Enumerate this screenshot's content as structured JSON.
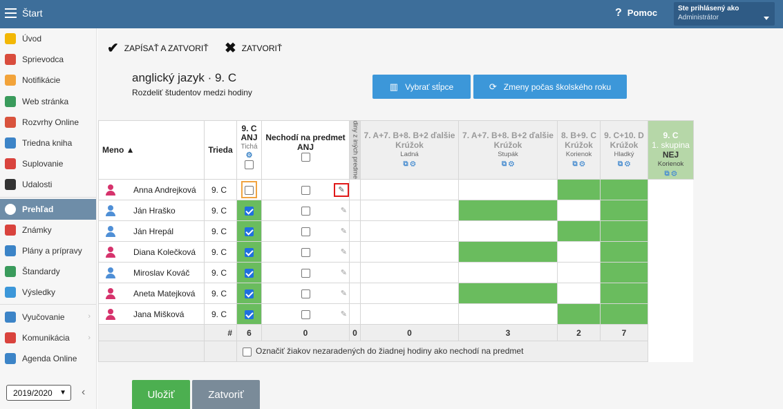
{
  "topbar": {
    "title": "Štart",
    "help": "Pomoc",
    "help_icon": "?",
    "user_label": "Ste prihlásený ako",
    "user_name": "Administrátor"
  },
  "sidebar": {
    "items": [
      {
        "label": "Úvod",
        "icon": "star-icon",
        "color": "#f2b705"
      },
      {
        "label": "Sprievodca",
        "icon": "wand-icon",
        "color": "#d94c3d"
      },
      {
        "label": "Notifikácie",
        "icon": "envelope-icon",
        "color": "#f2a33a"
      },
      {
        "label": "Web stránka",
        "icon": "house-icon",
        "color": "#3a9b5c"
      },
      {
        "label": "Rozvrhy Online",
        "icon": "calendar-grid-icon",
        "color": "#d9533d"
      },
      {
        "label": "Triedna kniha",
        "icon": "book-icon",
        "color": "#3c84c7"
      },
      {
        "label": "Suplovanie",
        "icon": "person-swap-icon",
        "color": "#d9433d"
      },
      {
        "label": "Udalosti",
        "icon": "calendar-icon",
        "color": "#333333"
      },
      {
        "label": "Prehľad",
        "icon": "check-circle-icon",
        "color": "#ffffff",
        "active": true
      },
      {
        "label": "Známky",
        "icon": "grade-icon",
        "color": "#d9433d"
      },
      {
        "label": "Plány a prípravy",
        "icon": "briefcase-icon",
        "color": "#3c84c7"
      },
      {
        "label": "Štandardy",
        "icon": "shield-icon",
        "color": "#3a9b5c"
      },
      {
        "label": "Výsledky",
        "icon": "bar-chart-icon",
        "color": "#3c97d9"
      },
      {
        "label": "Vyučovanie",
        "icon": "books-icon",
        "color": "#3c84c7",
        "chevron": true
      },
      {
        "label": "Komunikácia",
        "icon": "chat-icon",
        "color": "#d9433d",
        "chevron": true
      },
      {
        "label": "Agenda Online",
        "icon": "pencil-icon",
        "color": "#3c84c7"
      }
    ],
    "hidden_partial": "el",
    "year": "2019/2020",
    "collapse": "‹"
  },
  "actions": {
    "save_close": "ZAPÍSAŤ A ZATVORIŤ",
    "close": "ZATVORIŤ"
  },
  "course": {
    "title": "anglický jazyk · 9. C",
    "subtitle": "Rozdeliť študentov medzi hodiny"
  },
  "buttons": {
    "columns": "Vybrať stĺpce",
    "changes": "Zmeny počas školského roku"
  },
  "grid": {
    "h_name": "Meno ▲",
    "h_class": "Trieda",
    "h_anj": {
      "l1": "9. C",
      "l2": "ANJ",
      "teacher": "Tichá"
    },
    "h_nech": {
      "l1": "Nechodí na predmet",
      "l2": "ANJ"
    },
    "vertical": "Hodiny z iných predmetov",
    "groups": [
      {
        "l1": "7. A+7. B+8. B+2 ďalšie",
        "l2": "Krúžok",
        "teacher": "Ladná"
      },
      {
        "l1": "7. A+7. B+8. B+2 ďalšie",
        "l2": "Krúžok",
        "teacher": "Stupák"
      },
      {
        "l1": "8. B+9. C",
        "l2": "Krúžok",
        "teacher": "Korienok"
      },
      {
        "l1": "9. C+10. D",
        "l2": "Krúžok",
        "teacher": "Hladký"
      },
      {
        "l1": "9. C",
        "l2": "1. skupina",
        "l3": "NEJ",
        "teacher": "Korienok"
      }
    ],
    "students": [
      {
        "name": "Anna Andrejková",
        "class": "9. C",
        "gender": "f",
        "anj": false,
        "g": [
          false,
          false,
          false,
          true,
          true
        ]
      },
      {
        "name": "Ján Hraško",
        "class": "9. C",
        "gender": "m",
        "anj": true,
        "g": [
          false,
          false,
          true,
          false,
          true
        ]
      },
      {
        "name": "Ján Hrepál",
        "class": "9. C",
        "gender": "m",
        "anj": true,
        "g": [
          false,
          false,
          false,
          true,
          true
        ]
      },
      {
        "name": "Diana Kolečková",
        "class": "9. C",
        "gender": "f",
        "anj": true,
        "g": [
          false,
          false,
          true,
          false,
          true
        ]
      },
      {
        "name": "Miroslav Kováč",
        "class": "9. C",
        "gender": "m",
        "anj": true,
        "g": [
          false,
          false,
          false,
          false,
          true
        ]
      },
      {
        "name": "Aneta Matejková",
        "class": "9. C",
        "gender": "f",
        "anj": true,
        "g": [
          false,
          false,
          true,
          false,
          true
        ]
      },
      {
        "name": "Jana Mišková",
        "class": "9. C",
        "gender": "f",
        "anj": true,
        "g": [
          false,
          false,
          false,
          true,
          true
        ]
      }
    ],
    "sum_label": "#",
    "sums": {
      "anj": "6",
      "nech": "0",
      "groups": [
        "0",
        "0",
        "3",
        "2",
        "7"
      ]
    },
    "footer_text": "Označiť žiakov nezaradených do žiadnej hodiny ako nechodí na predmet"
  },
  "bottom": {
    "save": "Uložiť",
    "close": "Zatvoriť"
  },
  "colors": {
    "topbar": "#3d6e9a",
    "green": "#6abc5e",
    "blue_button": "#3c97d9",
    "save": "#4caf50",
    "close": "#7a8b99"
  }
}
